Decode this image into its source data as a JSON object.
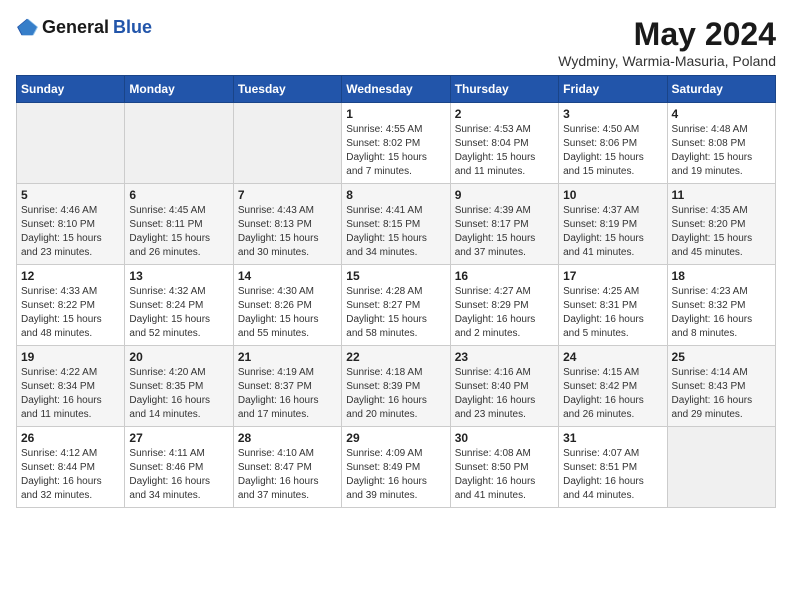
{
  "header": {
    "logo_general": "General",
    "logo_blue": "Blue",
    "title": "May 2024",
    "subtitle": "Wydminy, Warmia-Masuria, Poland"
  },
  "days_of_week": [
    "Sunday",
    "Monday",
    "Tuesday",
    "Wednesday",
    "Thursday",
    "Friday",
    "Saturday"
  ],
  "weeks": [
    [
      {
        "day": "",
        "info": ""
      },
      {
        "day": "",
        "info": ""
      },
      {
        "day": "",
        "info": ""
      },
      {
        "day": "1",
        "info": "Sunrise: 4:55 AM\nSunset: 8:02 PM\nDaylight: 15 hours\nand 7 minutes."
      },
      {
        "day": "2",
        "info": "Sunrise: 4:53 AM\nSunset: 8:04 PM\nDaylight: 15 hours\nand 11 minutes."
      },
      {
        "day": "3",
        "info": "Sunrise: 4:50 AM\nSunset: 8:06 PM\nDaylight: 15 hours\nand 15 minutes."
      },
      {
        "day": "4",
        "info": "Sunrise: 4:48 AM\nSunset: 8:08 PM\nDaylight: 15 hours\nand 19 minutes."
      }
    ],
    [
      {
        "day": "5",
        "info": "Sunrise: 4:46 AM\nSunset: 8:10 PM\nDaylight: 15 hours\nand 23 minutes."
      },
      {
        "day": "6",
        "info": "Sunrise: 4:45 AM\nSunset: 8:11 PM\nDaylight: 15 hours\nand 26 minutes."
      },
      {
        "day": "7",
        "info": "Sunrise: 4:43 AM\nSunset: 8:13 PM\nDaylight: 15 hours\nand 30 minutes."
      },
      {
        "day": "8",
        "info": "Sunrise: 4:41 AM\nSunset: 8:15 PM\nDaylight: 15 hours\nand 34 minutes."
      },
      {
        "day": "9",
        "info": "Sunrise: 4:39 AM\nSunset: 8:17 PM\nDaylight: 15 hours\nand 37 minutes."
      },
      {
        "day": "10",
        "info": "Sunrise: 4:37 AM\nSunset: 8:19 PM\nDaylight: 15 hours\nand 41 minutes."
      },
      {
        "day": "11",
        "info": "Sunrise: 4:35 AM\nSunset: 8:20 PM\nDaylight: 15 hours\nand 45 minutes."
      }
    ],
    [
      {
        "day": "12",
        "info": "Sunrise: 4:33 AM\nSunset: 8:22 PM\nDaylight: 15 hours\nand 48 minutes."
      },
      {
        "day": "13",
        "info": "Sunrise: 4:32 AM\nSunset: 8:24 PM\nDaylight: 15 hours\nand 52 minutes."
      },
      {
        "day": "14",
        "info": "Sunrise: 4:30 AM\nSunset: 8:26 PM\nDaylight: 15 hours\nand 55 minutes."
      },
      {
        "day": "15",
        "info": "Sunrise: 4:28 AM\nSunset: 8:27 PM\nDaylight: 15 hours\nand 58 minutes."
      },
      {
        "day": "16",
        "info": "Sunrise: 4:27 AM\nSunset: 8:29 PM\nDaylight: 16 hours\nand 2 minutes."
      },
      {
        "day": "17",
        "info": "Sunrise: 4:25 AM\nSunset: 8:31 PM\nDaylight: 16 hours\nand 5 minutes."
      },
      {
        "day": "18",
        "info": "Sunrise: 4:23 AM\nSunset: 8:32 PM\nDaylight: 16 hours\nand 8 minutes."
      }
    ],
    [
      {
        "day": "19",
        "info": "Sunrise: 4:22 AM\nSunset: 8:34 PM\nDaylight: 16 hours\nand 11 minutes."
      },
      {
        "day": "20",
        "info": "Sunrise: 4:20 AM\nSunset: 8:35 PM\nDaylight: 16 hours\nand 14 minutes."
      },
      {
        "day": "21",
        "info": "Sunrise: 4:19 AM\nSunset: 8:37 PM\nDaylight: 16 hours\nand 17 minutes."
      },
      {
        "day": "22",
        "info": "Sunrise: 4:18 AM\nSunset: 8:39 PM\nDaylight: 16 hours\nand 20 minutes."
      },
      {
        "day": "23",
        "info": "Sunrise: 4:16 AM\nSunset: 8:40 PM\nDaylight: 16 hours\nand 23 minutes."
      },
      {
        "day": "24",
        "info": "Sunrise: 4:15 AM\nSunset: 8:42 PM\nDaylight: 16 hours\nand 26 minutes."
      },
      {
        "day": "25",
        "info": "Sunrise: 4:14 AM\nSunset: 8:43 PM\nDaylight: 16 hours\nand 29 minutes."
      }
    ],
    [
      {
        "day": "26",
        "info": "Sunrise: 4:12 AM\nSunset: 8:44 PM\nDaylight: 16 hours\nand 32 minutes."
      },
      {
        "day": "27",
        "info": "Sunrise: 4:11 AM\nSunset: 8:46 PM\nDaylight: 16 hours\nand 34 minutes."
      },
      {
        "day": "28",
        "info": "Sunrise: 4:10 AM\nSunset: 8:47 PM\nDaylight: 16 hours\nand 37 minutes."
      },
      {
        "day": "29",
        "info": "Sunrise: 4:09 AM\nSunset: 8:49 PM\nDaylight: 16 hours\nand 39 minutes."
      },
      {
        "day": "30",
        "info": "Sunrise: 4:08 AM\nSunset: 8:50 PM\nDaylight: 16 hours\nand 41 minutes."
      },
      {
        "day": "31",
        "info": "Sunrise: 4:07 AM\nSunset: 8:51 PM\nDaylight: 16 hours\nand 44 minutes."
      },
      {
        "day": "",
        "info": ""
      }
    ]
  ]
}
